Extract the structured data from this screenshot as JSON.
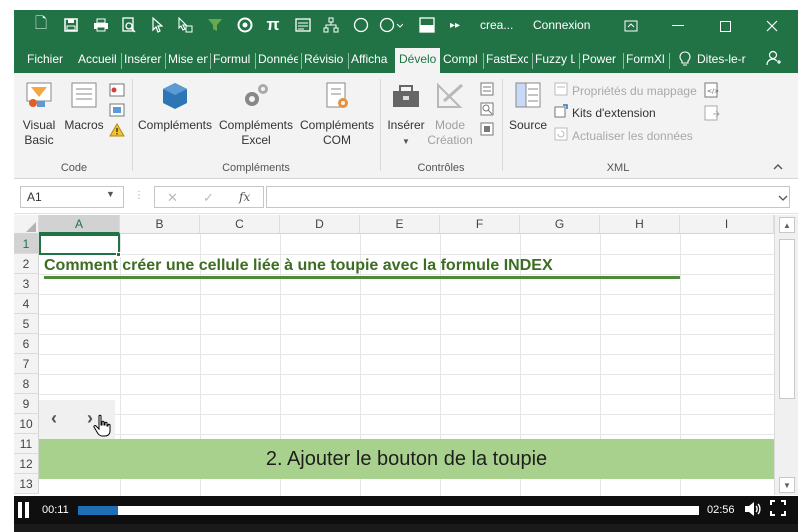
{
  "titlebar": {
    "title": "crea...",
    "signin": "Connexion",
    "qat_icons": [
      "new-file-icon",
      "save-icon",
      "print-icon",
      "print-preview-icon",
      "select-cursor-icon",
      "touch-mode-icon",
      "filter-icon",
      "record-icon",
      "pi-symbol-icon",
      "form-icon",
      "hierarchy-icon",
      "circle-icon",
      "circle-dropdown-icon",
      "fill-color-icon",
      "more-commands-icon"
    ]
  },
  "tabs": [
    {
      "label": "Fichier"
    },
    {
      "label": "Accueil"
    },
    {
      "label": "Insérer"
    },
    {
      "label": "Mise en"
    },
    {
      "label": "Formul"
    },
    {
      "label": "Donnée"
    },
    {
      "label": "Révisio"
    },
    {
      "label": "Afficha"
    },
    {
      "label": "Dévelo"
    },
    {
      "label": "Compl"
    },
    {
      "label": "FastExc"
    },
    {
      "label": "Fuzzy L"
    },
    {
      "label": "Power"
    },
    {
      "label": "FormXl"
    },
    {
      "label": "Dites-le-r"
    }
  ],
  "ribbon": {
    "code": {
      "label": "Code",
      "visual_basic": "Visual Basic",
      "macros": "Macros"
    },
    "complements": {
      "label": "Compléments",
      "complements": "Compléments",
      "excel": "Compléments Excel",
      "com": "Compléments COM"
    },
    "controles": {
      "label": "Contrôles",
      "inserer": "Insérer",
      "mode_creation": "Mode Création"
    },
    "xml": {
      "label": "XML",
      "source": "Source",
      "proprietes": "Propriétés du mappage",
      "kits": "Kits d'extension",
      "actualiser": "Actualiser les données"
    }
  },
  "formula_bar": {
    "namebox": "A1",
    "fx": "fx",
    "cancel": "✕",
    "confirm": "✓",
    "formula_value": ""
  },
  "grid": {
    "columns": [
      "A",
      "B",
      "C",
      "D",
      "E",
      "F",
      "G",
      "H",
      "I"
    ],
    "rows": [
      "1",
      "2",
      "3",
      "4",
      "5",
      "6",
      "7",
      "8",
      "9",
      "10",
      "11",
      "12",
      "13"
    ],
    "heading": "Comment créer une cellule liée à une toupie avec la formule INDEX",
    "banner": "2. Ajouter le bouton de la toupie",
    "spinner_left": "‹",
    "spinner_right": "›"
  },
  "player": {
    "current_time": "00:11",
    "total_time": "02:56",
    "progress": 0.065
  },
  "colors": {
    "excel_green": "#217346",
    "heading_green": "#3b6e22",
    "banner_green": "#a9d18e",
    "progress_blue": "#1f6fb4"
  }
}
